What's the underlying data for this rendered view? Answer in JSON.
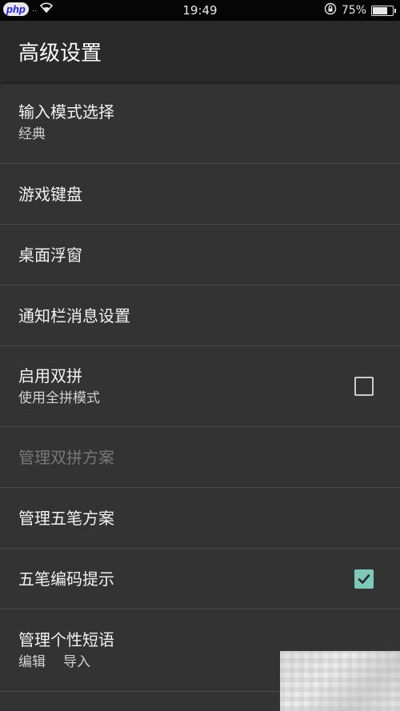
{
  "status_bar": {
    "logo_text": "php",
    "time": "19:49",
    "battery_percent": "75%",
    "battery_level": 0.75
  },
  "header": {
    "title": "高级设置"
  },
  "settings": {
    "input_mode": {
      "title": "输入模式选择",
      "summary": "经典"
    },
    "game_keyboard": {
      "title": "游戏键盘"
    },
    "floating_window": {
      "title": "桌面浮窗"
    },
    "notification": {
      "title": "通知栏消息设置"
    },
    "double_pinyin": {
      "title": "启用双拼",
      "summary": "使用全拼模式",
      "checked": false
    },
    "manage_double_pinyin": {
      "title": "管理双拼方案",
      "enabled": false
    },
    "manage_wubi": {
      "title": "管理五笔方案"
    },
    "wubi_hint": {
      "title": "五笔编码提示",
      "checked": true
    },
    "custom_phrases": {
      "title": "管理个性短语",
      "edit_label": "编辑",
      "import_label": "导入"
    }
  },
  "colors": {
    "background": "#333333",
    "app_bar": "#2a2a2a",
    "status_bar": "#050505",
    "accent": "#7ec8b8",
    "divider": "#4a4a4a",
    "disabled_text": "#777777"
  },
  "icons": [
    "wifi-icon",
    "lock-rotation-icon",
    "battery-icon",
    "checkbox-icon",
    "checkmark-icon"
  ]
}
